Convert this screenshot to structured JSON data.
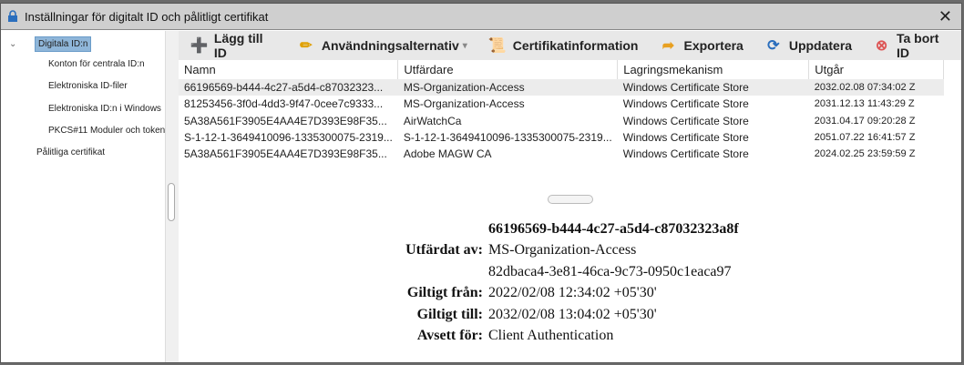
{
  "window": {
    "title": "Inställningar för digitalt ID och pålitligt certifikat"
  },
  "sidebar": {
    "items": [
      {
        "label": "Digitala ID:n"
      },
      {
        "label": "Konton för centrala ID:n"
      },
      {
        "label": "Elektroniska ID-filer"
      },
      {
        "label": "Elektroniska ID:n i Windows"
      },
      {
        "label": "PKCS#11 Moduler och token"
      },
      {
        "label": "Pålitliga certifikat"
      }
    ]
  },
  "toolbar": {
    "add": "Lägg till ID",
    "usage": "Användningsalternativ",
    "certinfo": "Certifikatinformation",
    "export": "Exportera",
    "refresh": "Uppdatera",
    "remove": "Ta bort ID"
  },
  "table": {
    "headers": [
      "Namn",
      "Utfärdare",
      "Lagringsmekanism",
      "Utgår"
    ],
    "rows": [
      [
        "66196569-b444-4c27-a5d4-c87032323...",
        "MS-Organization-Access",
        "Windows Certificate Store",
        "2032.02.08 07:34:02 Z"
      ],
      [
        "81253456-3f0d-4dd3-9f47-0cee7c9333...",
        "MS-Organization-Access",
        "Windows Certificate Store",
        "2031.12.13 11:43:29 Z"
      ],
      [
        "5A38A561F3905E4AA4E7D393E98F35...",
        "AirWatchCa",
        "Windows Certificate Store",
        "2031.04.17 09:20:28 Z"
      ],
      [
        "S-1-12-1-3649410096-1335300075-2319...",
        "S-1-12-1-3649410096-1335300075-2319...",
        "Windows Certificate Store",
        "2051.07.22 16:41:57 Z"
      ],
      [
        "5A38A561F3905E4AA4E7D393E98F35...",
        "Adobe MAGW CA",
        "Windows Certificate Store",
        "2024.02.25 23:59:59 Z"
      ]
    ]
  },
  "details": {
    "name": "66196569-b444-4c27-a5d4-c87032323a8f",
    "issued_by_label": "Utfärdat av:",
    "issued_by": "MS-Organization-Access",
    "issued_by_id": "82dbaca4-3e81-46ca-9c73-0950c1eaca97",
    "valid_from_label": "Giltigt från:",
    "valid_from": "2022/02/08 12:34:02 +05'30'",
    "valid_to_label": "Giltigt till:",
    "valid_to": "2032/02/08 13:04:02 +05'30'",
    "purpose_label": "Avsett för:",
    "purpose": "Client Authentication"
  }
}
